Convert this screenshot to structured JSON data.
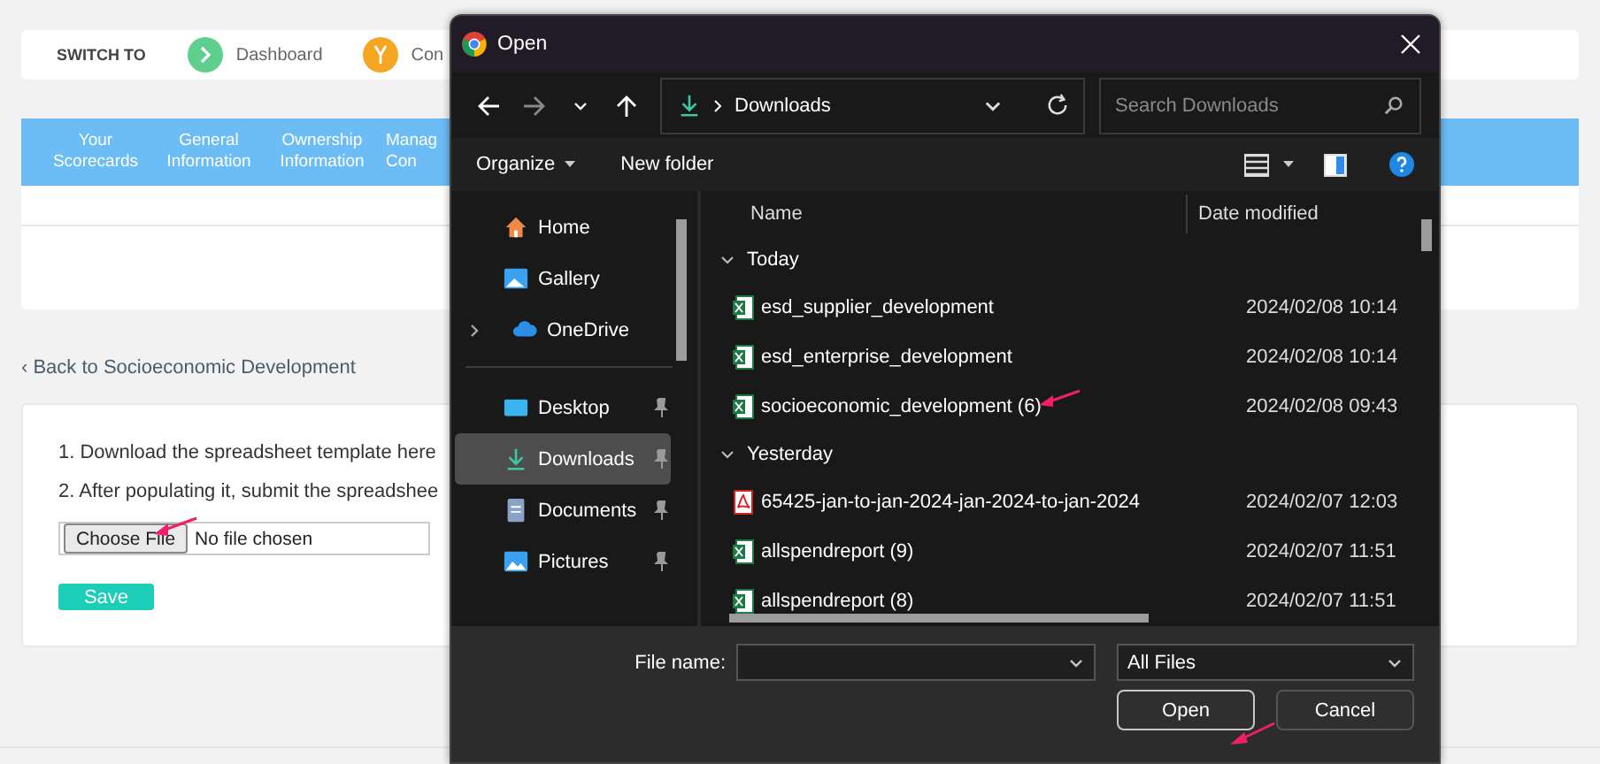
{
  "page": {
    "switch_to": {
      "label": "SWITCH TO",
      "items": [
        {
          "label": "Dashboard",
          "kind": "dashboard"
        },
        {
          "label": "Con",
          "kind": "compare"
        }
      ]
    },
    "tabs": [
      {
        "lines": [
          "Your",
          "Scorecards"
        ]
      },
      {
        "lines": [
          "General",
          "Information"
        ]
      },
      {
        "lines": [
          "Ownership",
          "Information"
        ]
      },
      {
        "lines": [
          "Manag",
          "Con"
        ]
      }
    ],
    "back_link": "‹ Back to Socioeconomic Development",
    "steps": [
      "1. Download the spreadsheet template here",
      "2. After populating it, submit the spreadshee"
    ],
    "file_input": {
      "button": "Choose File",
      "status": "No file chosen"
    },
    "save_button": "Save"
  },
  "dialog": {
    "title": "Open",
    "location": "Downloads",
    "search": {
      "placeholder": "Search Downloads"
    },
    "commands": [
      "Organize",
      "New folder"
    ],
    "sidebar": {
      "locations": [
        {
          "label": "Home",
          "kind": "home",
          "expandable": false,
          "pinned": false,
          "selected": false
        },
        {
          "label": "Gallery",
          "kind": "gallery",
          "expandable": false,
          "pinned": false,
          "selected": false
        },
        {
          "label": "OneDrive",
          "kind": "cloud",
          "expandable": true,
          "pinned": false,
          "selected": false
        }
      ],
      "quick_access": [
        {
          "label": "Desktop",
          "kind": "desktop",
          "expandable": false,
          "pinned": true,
          "selected": false
        },
        {
          "label": "Downloads",
          "kind": "download",
          "expandable": false,
          "pinned": true,
          "selected": true
        },
        {
          "label": "Documents",
          "kind": "document",
          "expandable": false,
          "pinned": true,
          "selected": false
        },
        {
          "label": "Pictures",
          "kind": "picture",
          "expandable": false,
          "pinned": true,
          "selected": false
        }
      ]
    },
    "columns": [
      "Name",
      "Date modified"
    ],
    "groups": [
      {
        "label": "Today",
        "expanded": true,
        "files": [
          {
            "name": "esd_supplier_development",
            "kind": "excel",
            "date": "2024/02/08 10:14"
          },
          {
            "name": "esd_enterprise_development",
            "kind": "excel",
            "date": "2024/02/08 10:14"
          },
          {
            "name": "socioeconomic_development (6)",
            "kind": "excel",
            "date": "2024/02/08 09:43"
          }
        ]
      },
      {
        "label": "Yesterday",
        "expanded": true,
        "files": [
          {
            "name": "65425-jan-to-jan-2024-jan-2024-to-jan-2024",
            "kind": "pdf",
            "date": "2024/02/07 12:03"
          },
          {
            "name": "allspendreport (9)",
            "kind": "excel",
            "date": "2024/02/07 11:51"
          },
          {
            "name": "allspendreport (8)",
            "kind": "excel",
            "date": "2024/02/07 11:51"
          }
        ]
      }
    ],
    "file_name_label": "File name:",
    "file_type": "All Files",
    "buttons": [
      {
        "label": "Open",
        "kind": "primary"
      },
      {
        "label": "Cancel",
        "kind": "secondary"
      }
    ]
  }
}
